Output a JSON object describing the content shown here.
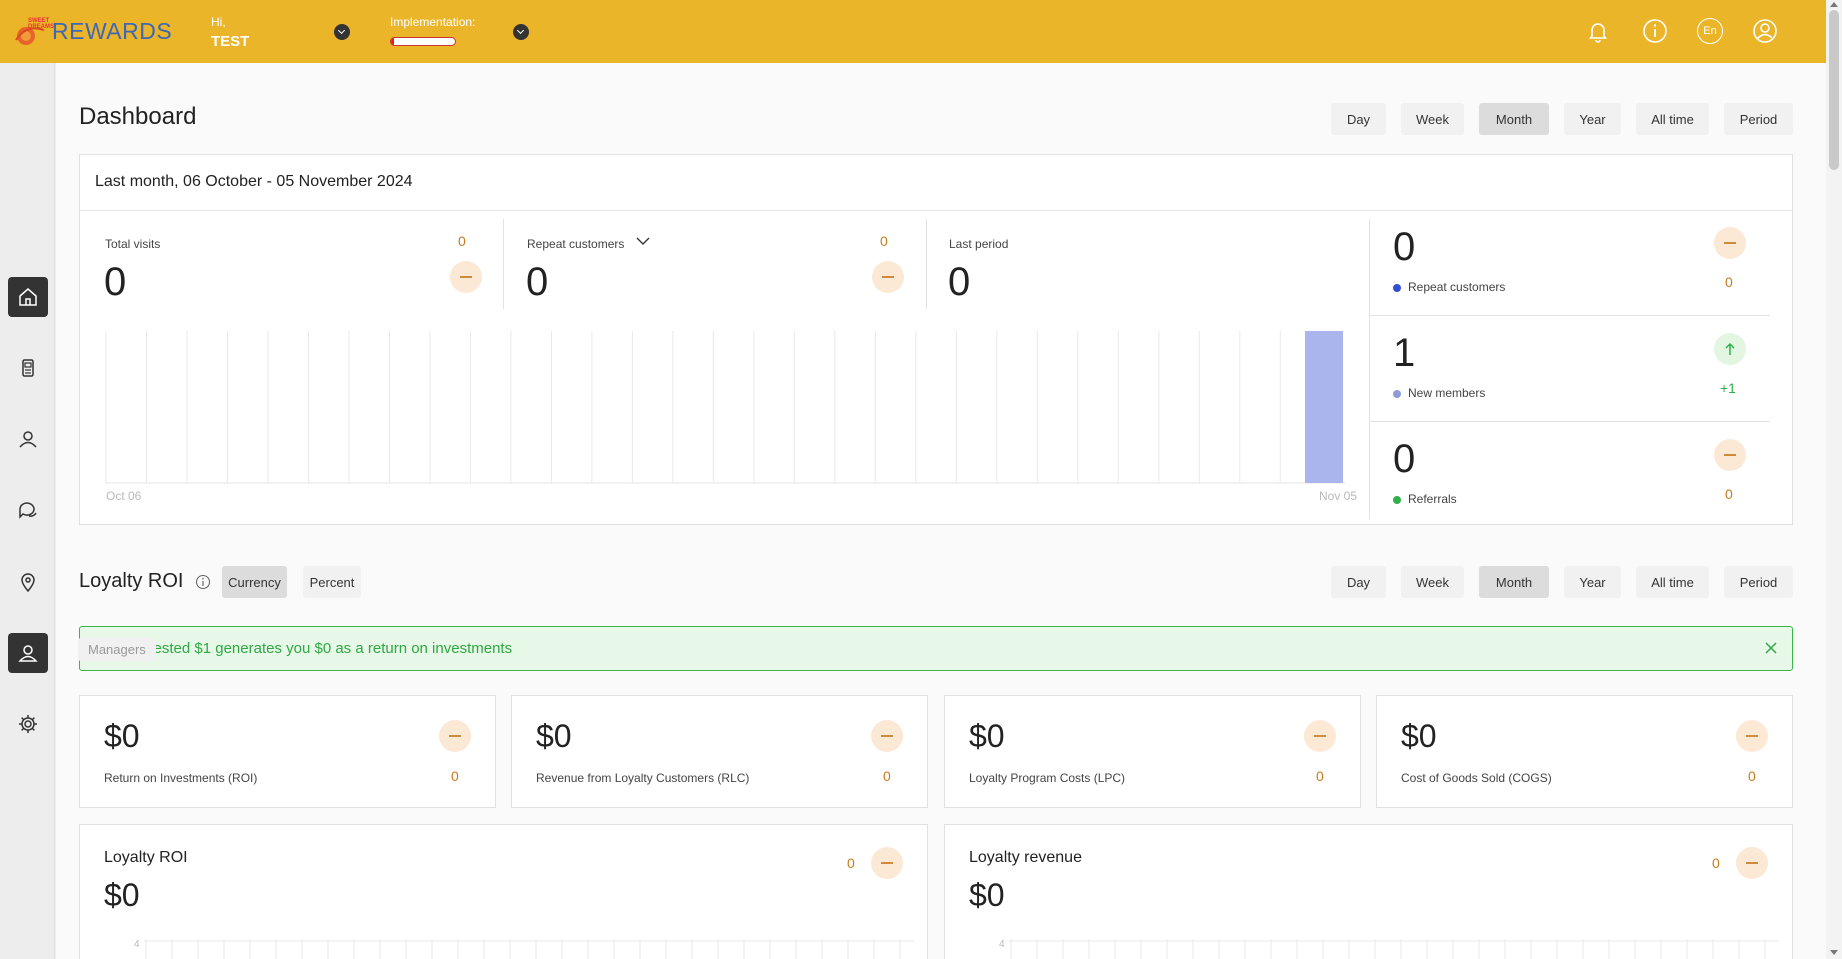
{
  "header": {
    "logo_text": "REWARDS",
    "logo_small": "SWEET DREAMS",
    "greeting": "Hi,",
    "user_name": "TEST",
    "implementation_label": "Implementation:",
    "implementation_progress": 0.05,
    "language": "En"
  },
  "sidebar": {
    "items": [
      {
        "name": "home"
      },
      {
        "name": "device"
      },
      {
        "name": "customers"
      },
      {
        "name": "messages"
      },
      {
        "name": "locations"
      },
      {
        "name": "managers"
      },
      {
        "name": "settings"
      }
    ],
    "tooltip": "Managers"
  },
  "dashboard": {
    "title": "Dashboard",
    "periods": [
      "Day",
      "Week",
      "Month",
      "Year",
      "All time",
      "Period"
    ],
    "active_period": "Month",
    "range_title": "Last month, 06 October - 05 November 2024",
    "metrics": [
      {
        "label": "Total visits",
        "value": "0",
        "delta": "0"
      },
      {
        "label": "Repeat customers",
        "value": "0",
        "delta": "0"
      },
      {
        "label": "Last period",
        "value": "0"
      }
    ],
    "side_stats": [
      {
        "value": "0",
        "label": "Repeat customers",
        "delta": "0",
        "color": "#2f4fd0"
      },
      {
        "value": "1",
        "label": "New members",
        "delta": "+1",
        "color": "#8d9bd6"
      },
      {
        "value": "0",
        "label": "Referrals",
        "delta": "0",
        "color": "#2fb14a"
      }
    ],
    "chart_x_start": "Oct 06",
    "chart_x_end": "Nov 05"
  },
  "chart_data": {
    "type": "bar",
    "categories": [
      "Oct 06",
      "",
      "",
      "",
      "",
      "",
      "",
      "",
      "",
      "",
      "",
      "",
      "",
      "",
      "",
      "",
      "",
      "",
      "",
      "",
      "",
      "",
      "",
      "",
      "",
      "",
      "",
      "",
      "",
      "",
      "Nov 05"
    ],
    "values": [
      0,
      0,
      0,
      0,
      0,
      0,
      0,
      0,
      0,
      0,
      0,
      0,
      0,
      0,
      0,
      0,
      0,
      0,
      0,
      0,
      0,
      0,
      0,
      0,
      0,
      0,
      0,
      0,
      0,
      0,
      1
    ],
    "ylim": [
      0,
      1
    ],
    "grid": true,
    "colors": {
      "bar": "#a9b5ec"
    }
  },
  "roi": {
    "title": "Loyalty ROI",
    "modes": [
      "Currency",
      "Percent"
    ],
    "active_mode": "Currency",
    "periods": [
      "Day",
      "Week",
      "Month",
      "Year",
      "All time",
      "Period"
    ],
    "active_period": "Month",
    "banner": "Each invested $1 generates you $0 as a return on investments",
    "cards": [
      {
        "value": "$0",
        "label": "Return on Investments (ROI)",
        "delta": "0"
      },
      {
        "value": "$0",
        "label": "Revenue from Loyalty Customers (RLC)",
        "delta": "0"
      },
      {
        "value": "$0",
        "label": "Loyalty Program Costs (LPC)",
        "delta": "0"
      },
      {
        "value": "$0",
        "label": "Cost of Goods Sold (COGS)",
        "delta": "0"
      }
    ],
    "bottom_cards": [
      {
        "title": "Loyalty ROI",
        "value": "$0",
        "delta": "0",
        "axis_top": "4"
      },
      {
        "title": "Loyalty revenue",
        "value": "$0",
        "delta": "0",
        "axis_top": "4"
      }
    ]
  }
}
